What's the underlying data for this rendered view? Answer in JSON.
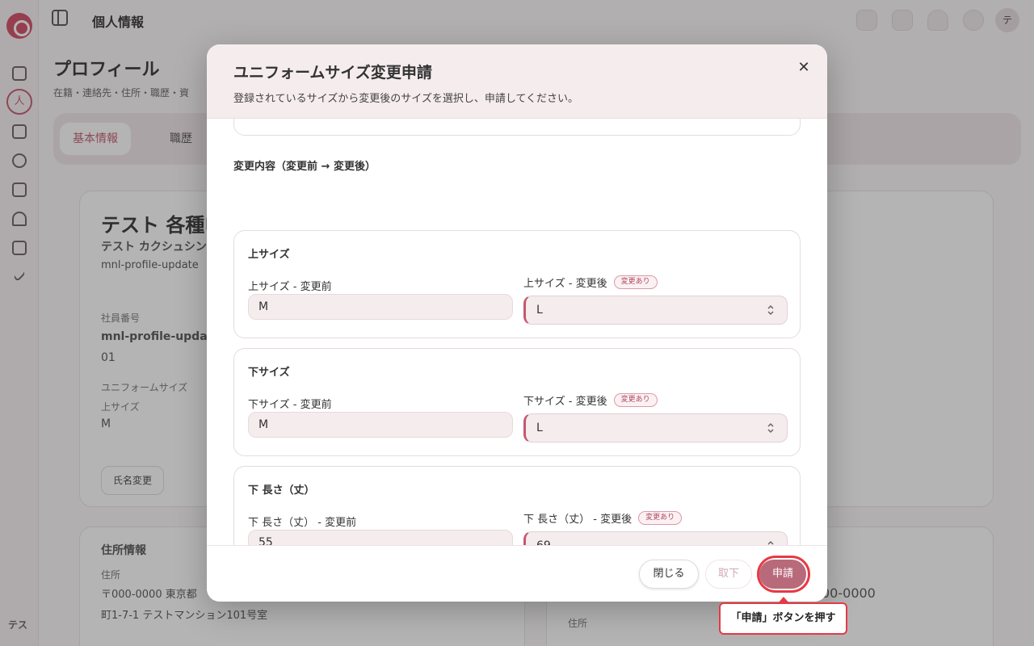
{
  "app": {
    "page_title": "個人情報",
    "user_avatar_initial": "テ",
    "sidebar_user_label": "テス"
  },
  "background": {
    "heading": "プロフィール",
    "subheading": "在籍・連絡先・住所・職歴・資",
    "tabs": [
      "基本情報",
      "職歴"
    ],
    "name_large": "テスト 各種申",
    "name_kana": "テスト カクシュシン",
    "profile_id": "mnl-profile-update",
    "employee_number_label": "社員番号",
    "employee_number_value": "mnl-profile-upda",
    "employee_number_suffix": "01",
    "uniform_size_label": "ユニフォームサイズ",
    "top_size_label": "上サイズ",
    "top_size_value": "M",
    "rename_button": "氏名変更",
    "address_section_title": "住所情報",
    "address_label": "住所",
    "address_postal": "〒000-0000 東京都",
    "address_line": "町1-7-1 テストマンション101号室",
    "right_postal": "00-0000",
    "right_address_label": "住所"
  },
  "modal": {
    "title": "ユニフォームサイズ変更申請",
    "description": "登録されているサイズから変更後のサイズを選択し、申請してください。",
    "section_heading": "変更内容（変更前 → 変更後）",
    "change_badge": "変更あり",
    "items": [
      {
        "title": "上サイズ",
        "before_label": "上サイズ - 変更前",
        "before_value": "M",
        "after_label": "上サイズ - 変更後",
        "after_value": "L"
      },
      {
        "title": "下サイズ",
        "before_label": "下サイズ - 変更前",
        "before_value": "M",
        "after_label": "下サイズ - 変更後",
        "after_value": "L"
      },
      {
        "title": "下 長さ（丈）",
        "before_label": "下 長さ（丈） - 変更前",
        "before_value": "55",
        "after_label": "下 長さ（丈） - 変更後",
        "after_value": "69"
      }
    ],
    "footer": {
      "close_label": "閉じる",
      "withdraw_label": "取下",
      "submit_label": "申請"
    }
  },
  "tooltip": {
    "text": "「申請」ボタンを押す"
  },
  "colors": {
    "accent": "#c45870",
    "submit": "#b86a7b",
    "highlight": "#e53a45",
    "modal_header_bg": "#f5ecee"
  },
  "icons": [
    "close-icon",
    "chevron-up-down-icon",
    "panel-toggle-icon",
    "chat-icon",
    "calendar-icon",
    "bell-icon",
    "message-icon"
  ]
}
